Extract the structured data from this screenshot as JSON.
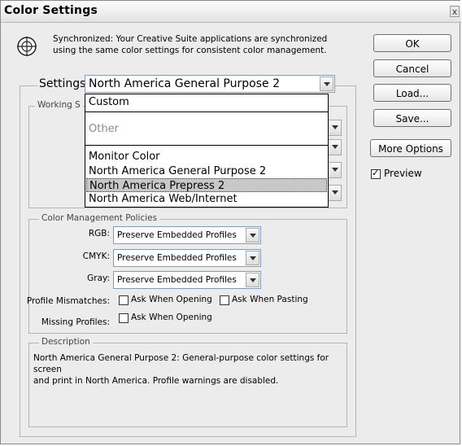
{
  "window": {
    "title": "Color Settings",
    "close_glyph": "x"
  },
  "sync": {
    "icon": "color-sync-icon",
    "line1": "Synchronized: Your Creative Suite applications are synchronized",
    "line2": "using the same color settings for consistent color management."
  },
  "buttons": {
    "ok": "OK",
    "cancel": "Cancel",
    "load": "Load...",
    "save": "Save...",
    "more_options": "More Options"
  },
  "preview": {
    "label": "Preview",
    "checked": true
  },
  "settings": {
    "label": "Settings:",
    "value": "North America General Purpose 2",
    "dropdown": {
      "items": [
        {
          "label": "Custom",
          "state": "normal"
        },
        {
          "label": "Other",
          "state": "disabled"
        },
        {
          "label": "Monitor Color",
          "state": "normal"
        },
        {
          "label": "North America General Purpose 2",
          "state": "normal"
        },
        {
          "label": "North America Prepress 2",
          "state": "selected"
        },
        {
          "label": "North America Web/Internet",
          "state": "normal"
        }
      ]
    }
  },
  "working_spaces": {
    "label": "Working S"
  },
  "color_management": {
    "label": "Color Management Policies",
    "rgb_label": "RGB:",
    "rgb_value": "Preserve Embedded Profiles",
    "cmyk_label": "CMYK:",
    "cmyk_value": "Preserve Embedded Profiles",
    "gray_label": "Gray:",
    "gray_value": "Preserve Embedded Profiles",
    "mismatch_label": "Profile Mismatches:",
    "ask_opening": "Ask When Opening",
    "ask_pasting": "Ask When Pasting",
    "missing_label": "Missing Profiles:",
    "missing_ask_opening": "Ask When Opening"
  },
  "description": {
    "label": "Description",
    "line1": "North America General Purpose 2:  General-purpose color settings for screen",
    "line2": "and print in North America. Profile warnings are disabled."
  }
}
